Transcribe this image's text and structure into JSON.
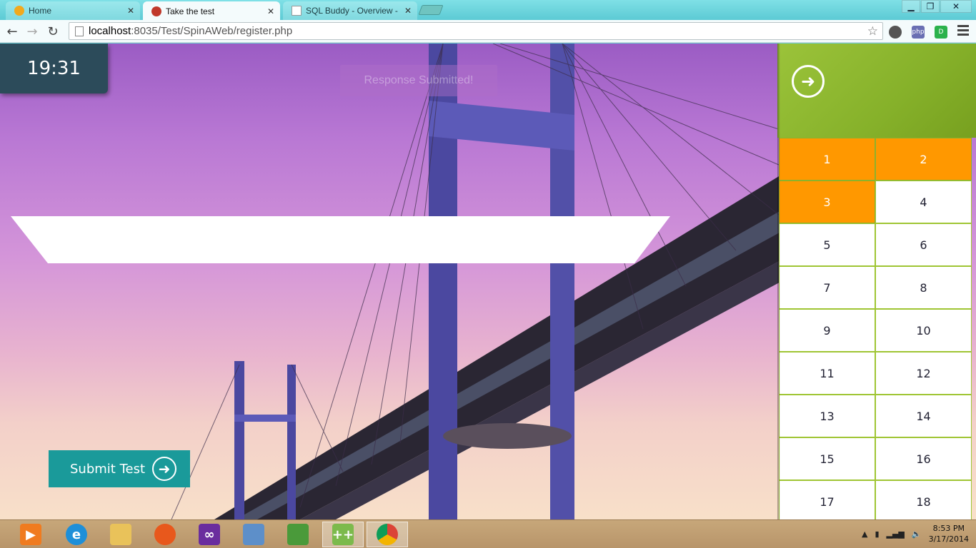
{
  "browser": {
    "tabs": [
      {
        "title": "Home",
        "icon": "home-icon",
        "active": false
      },
      {
        "title": "Take the test",
        "icon": "bird-icon",
        "active": true
      },
      {
        "title": "SQL Buddy - Overview - s",
        "icon": "page-icon",
        "active": false
      }
    ],
    "url_host": "localhost",
    "url_rest": ":8035/Test/SpinAWeb/register.php",
    "extensions": [
      "php",
      "D"
    ]
  },
  "page": {
    "timer": "19:31",
    "toast": "Response Submitted!",
    "submit_label": "Submit Test",
    "questions": [
      {
        "num": "1",
        "answered": true
      },
      {
        "num": "2",
        "answered": true
      },
      {
        "num": "3",
        "answered": true
      },
      {
        "num": "4",
        "answered": false
      },
      {
        "num": "5",
        "answered": false
      },
      {
        "num": "6",
        "answered": false
      },
      {
        "num": "7",
        "answered": false
      },
      {
        "num": "8",
        "answered": false
      },
      {
        "num": "9",
        "answered": false
      },
      {
        "num": "10",
        "answered": false
      },
      {
        "num": "11",
        "answered": false
      },
      {
        "num": "12",
        "answered": false
      },
      {
        "num": "13",
        "answered": false
      },
      {
        "num": "14",
        "answered": false
      },
      {
        "num": "15",
        "answered": false
      },
      {
        "num": "16",
        "answered": false
      },
      {
        "num": "17",
        "answered": false
      },
      {
        "num": "18",
        "answered": false
      }
    ],
    "colors": {
      "answered": "#ff9800",
      "panel_green": "#8cb22c",
      "submit": "#1a9a9a",
      "timer_bg": "#2c4b5a"
    }
  },
  "taskbar": {
    "apps": [
      "media-player-icon",
      "internet-explorer-icon",
      "file-explorer-icon",
      "firefox-icon",
      "visual-studio-icon",
      "virtualbox-icon",
      "evernote-icon",
      "notepad-plus-icon",
      "chrome-icon"
    ],
    "time": "8:53 PM",
    "date": "3/17/2014"
  }
}
